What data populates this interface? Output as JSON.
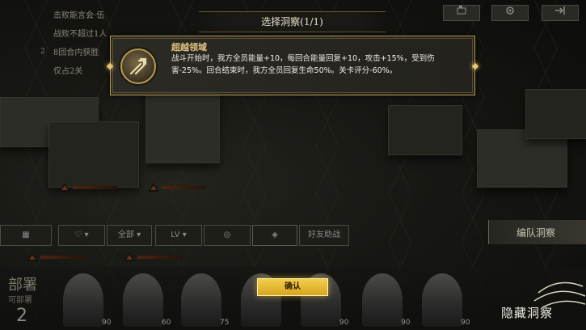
{
  "objectives": [
    {
      "num": "",
      "text": "击败能言会·伍"
    },
    {
      "num": "",
      "text": "战败不超过1人"
    },
    {
      "num": "2",
      "text": "8回合内获胜"
    },
    {
      "num": "",
      "text": "仅占2关"
    }
  ],
  "dialog": {
    "title": "选择洞察(1/1)",
    "insight_name": "超越领域",
    "insight_desc": "战斗开始时，我方全员能量+10，每回合能量回复+10，攻击+15%，受到伤害-25%。回合结束时，我方全员回复生命50%。关卡评分-60%。"
  },
  "filters": {
    "level": "LV",
    "friend": "好友助战",
    "sort": "全部"
  },
  "squad_button": "编队洞察",
  "deploy": {
    "label": "部署",
    "sub": "可部署",
    "count": "2"
  },
  "confirm_label": "确认",
  "hide_label": "隐藏洞察",
  "levels": [
    "90",
    "60",
    "75",
    "90",
    "90",
    "90",
    "90"
  ]
}
